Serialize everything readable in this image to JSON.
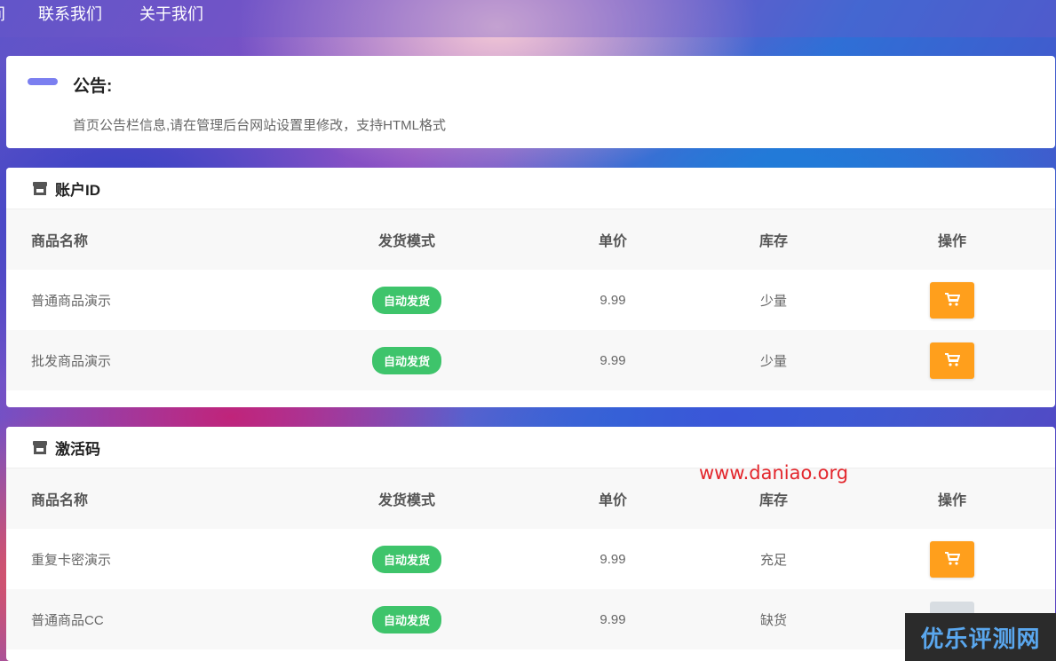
{
  "nav": {
    "items": [
      {
        "label": "间"
      },
      {
        "label": "联系我们"
      },
      {
        "label": "关于我们"
      }
    ]
  },
  "notice": {
    "title": "公告:",
    "text": "首页公告栏信息,请在管理后台网站设置里修改，支持HTML格式"
  },
  "columns": {
    "name": "商品名称",
    "mode": "发货模式",
    "price": "单价",
    "stock": "库存",
    "op": "操作"
  },
  "groups": [
    {
      "title": "账户ID",
      "products": [
        {
          "name": "普通商品演示",
          "mode": "自动发货",
          "price": "9.99",
          "stock": "少量",
          "buy_enabled": true
        },
        {
          "name": "批发商品演示",
          "mode": "自动发货",
          "price": "9.99",
          "stock": "少量",
          "buy_enabled": true
        }
      ]
    },
    {
      "title": "激活码",
      "products": [
        {
          "name": "重复卡密演示",
          "mode": "自动发货",
          "price": "9.99",
          "stock": "充足",
          "buy_enabled": true
        },
        {
          "name": "普通商品CC",
          "mode": "自动发货",
          "price": "9.99",
          "stock": "缺货",
          "buy_enabled": false
        }
      ]
    }
  ],
  "watermarks": {
    "url": "www.daniao.org",
    "logo": "优乐评测网"
  },
  "icons": {
    "group": "shop-icon",
    "buy": "cart-icon"
  },
  "colors": {
    "accent_bar": "#7b7ff0",
    "badge": "#3ec46b",
    "buy_button": "#ff9f1c",
    "buy_button_disabled": "#d8dde2"
  }
}
